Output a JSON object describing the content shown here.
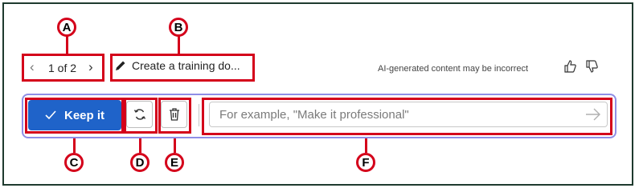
{
  "callouts": [
    "A",
    "B",
    "C",
    "D",
    "E",
    "F"
  ],
  "pager": {
    "text": "1 of 2",
    "prev_icon": "chevron-left-icon",
    "next_icon": "chevron-right-icon"
  },
  "draft": {
    "title": "Create a training do...",
    "icon": "pencil-icon"
  },
  "disclaimer": "AI-generated content may be incorrect",
  "feedback": {
    "like_icon": "thumbs-up-icon",
    "dislike_icon": "thumbs-down-icon"
  },
  "actions": {
    "keep_label": "Keep it",
    "keep_icon": "checkmark-icon",
    "regenerate_icon": "refresh-icon",
    "discard_icon": "trash-icon"
  },
  "prompt": {
    "placeholder": "For example, \"Make it professional\"",
    "value": "",
    "send_icon": "arrow-right-icon"
  },
  "colors": {
    "accent": "#1f63c9",
    "highlight": "#d4001a",
    "bar_border": "#8f8ee6"
  }
}
